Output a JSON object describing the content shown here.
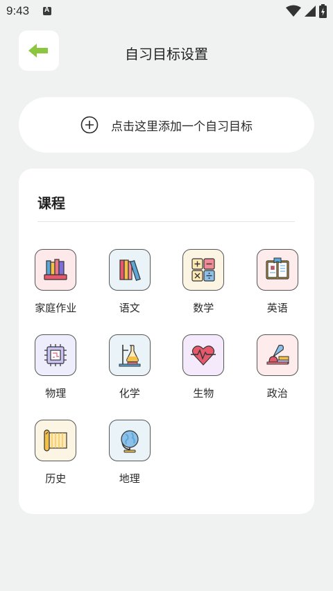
{
  "status_bar": {
    "time": "9:43"
  },
  "header": {
    "title": "自习目标设置"
  },
  "add_goal": {
    "label": "点击这里添加一个自习目标"
  },
  "courses": {
    "title": "课程",
    "items": [
      {
        "label": "家庭作业",
        "icon": "books-stack-icon",
        "bg": "#fde9ea"
      },
      {
        "label": "语文",
        "icon": "books-shelf-icon",
        "bg": "#eaf4f8"
      },
      {
        "label": "数学",
        "icon": "calculator-icon",
        "bg": "#fdf5e3"
      },
      {
        "label": "英语",
        "icon": "open-book-icon",
        "bg": "#fdeceb"
      },
      {
        "label": "物理",
        "icon": "circuit-chip-icon",
        "bg": "#eeedfb"
      },
      {
        "label": "化学",
        "icon": "flask-stand-icon",
        "bg": "#eaf4f8"
      },
      {
        "label": "生物",
        "icon": "heartbeat-icon",
        "bg": "#f4eafb"
      },
      {
        "label": "政治",
        "icon": "quill-ink-icon",
        "bg": "#fdeceb"
      },
      {
        "label": "历史",
        "icon": "scroll-icon",
        "bg": "#fdf5e3"
      },
      {
        "label": "地理",
        "icon": "globe-icon",
        "bg": "#eaf4f8"
      }
    ]
  },
  "colors": {
    "accent": "#8cc63f",
    "background": "#f0f1f1",
    "card": "#ffffff"
  }
}
